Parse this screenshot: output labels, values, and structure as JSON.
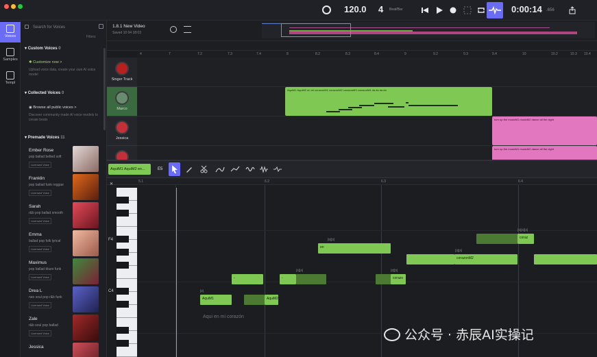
{
  "transport": {
    "tempo": "120.0",
    "beats": "4",
    "beat_bar": "Beat/Bar",
    "time": "0:00:14",
    "time_frac": ".656"
  },
  "leftnav": {
    "voices": "Voices",
    "samples": "Samples",
    "templates": "Templ"
  },
  "sidebar": {
    "search_placeholder": "Search for Voices",
    "filters": "Filters",
    "custom_voices": {
      "title": "Custom Voices",
      "count": "0",
      "cta": "Customize now >",
      "desc": "Upload voice data, create your own AI voice model"
    },
    "collected_voices": {
      "title": "Collected Voices",
      "count": "0",
      "cta": "Browse all public voices >",
      "desc": "Discover community made AI voice models to create beats"
    },
    "premade_voices": {
      "title": "Premade Voices",
      "count": "11"
    },
    "voices": [
      {
        "name": "Ember Rose",
        "desc": "pop ballad belted soft",
        "badge": "Licensed Voice",
        "color": "#c8b8b4"
      },
      {
        "name": "Franklin",
        "desc": "pop ballad funk reggae",
        "badge": "Licensed Voice",
        "color": "#c8491d"
      },
      {
        "name": "Sarah",
        "desc": "r&b pop ballad smooth",
        "badge": "Licensed Voice",
        "color": "#c2303e"
      },
      {
        "name": "Emma",
        "desc": "ballad pop folk lyrical",
        "badge": "Licensed Voice",
        "color": "#d8a28c"
      },
      {
        "name": "Maximus",
        "desc": "pop ballad blues funk",
        "badge": "Licensed Voice",
        "color": "#7b2034"
      },
      {
        "name": "Drea L",
        "desc": "neo soul pop r&b funk",
        "badge": "Licensed Voice",
        "color": "#3b3f8e"
      },
      {
        "name": "Zale",
        "desc": "r&b soul pop ballad",
        "badge": "Licensed Voice",
        "color": "#7c1d1d"
      },
      {
        "name": "Jessica",
        "desc": "",
        "badge": "",
        "color": "#b43f49"
      }
    ]
  },
  "project": {
    "title": "1.8.1 New Video",
    "subtitle": "Saved 10 04 18:03"
  },
  "ruler_top": [
    "4",
    "7",
    "7.2",
    "7.3",
    "7.4",
    "8",
    "8.2",
    "8.3",
    "8.4",
    "9",
    "9.2",
    "9.3",
    "9.4",
    "10",
    "10.2",
    "10.3",
    "10.4"
  ],
  "tracks": [
    {
      "name": "Singer Track",
      "color": "#c73030",
      "clip_text": ""
    },
    {
      "name": "Marco",
      "color": "#3d6f45",
      "clip_text": "AquiM1 AquiM2 en mi corazonM1 corazonM2 corazonM3 corazonM4 da da da da"
    },
    {
      "name": "Jessica",
      "color": "#b43f49",
      "clip_text": "turn up the musicM1 musicM2 dance all the night"
    },
    {
      "name": "Jessica",
      "color": "#b43f49",
      "clip_text": "turn up the musicM1 musicM2 dance all the night"
    }
  ],
  "piano_toolbar": {
    "track_label": "AquiM1 AquiM2 en...",
    "key": "E5"
  },
  "piano_ruler": [
    "5.1",
    "6.2",
    "6.3",
    "6.4"
  ],
  "keys": {
    "f4": "F4",
    "c4": "C4"
  },
  "notes": [
    {
      "label": "AquiM1",
      "above": "[2]"
    },
    {
      "label": "AquiM2",
      "above": ""
    },
    {
      "label": "-",
      "above": ""
    },
    {
      "label": "-",
      "above": "[4][4]"
    },
    {
      "label": "en",
      "above": "[5][3]"
    },
    {
      "label": "corazo",
      "above": "[3][3]"
    },
    {
      "label": "corazonM2",
      "above": "[3][4]"
    },
    {
      "label": "coraz",
      "above": "[4][4][4]"
    }
  ],
  "lyrics_hint": "Aqui en mi corazón",
  "watermark": "公众号 · 赤辰AI实操记"
}
